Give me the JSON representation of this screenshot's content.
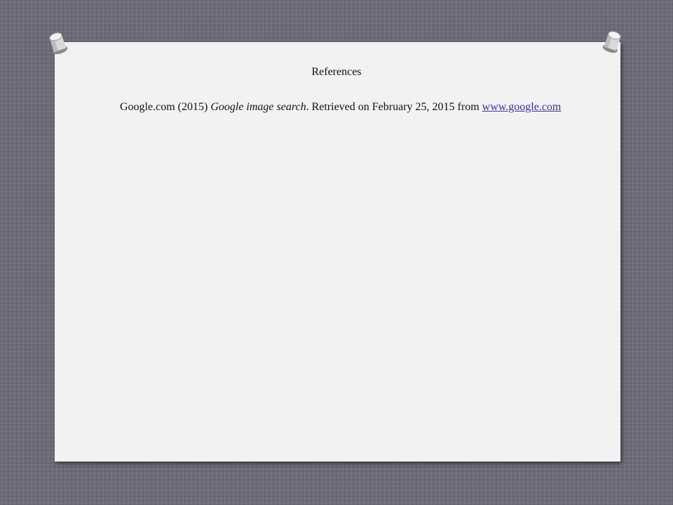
{
  "slide": {
    "title": "References",
    "reference": {
      "prefix": "Google.com (2015) ",
      "title_italic": "Google image search",
      "suffix": ". Retrieved on February 25, 2015 from ",
      "link_text": "www.google.com"
    }
  },
  "colors": {
    "background": "#6e6a78",
    "paper": "#f2f2f2",
    "link": "#3a2aa8"
  },
  "icons": [
    "pushpin-icon",
    "pushpin-icon"
  ]
}
